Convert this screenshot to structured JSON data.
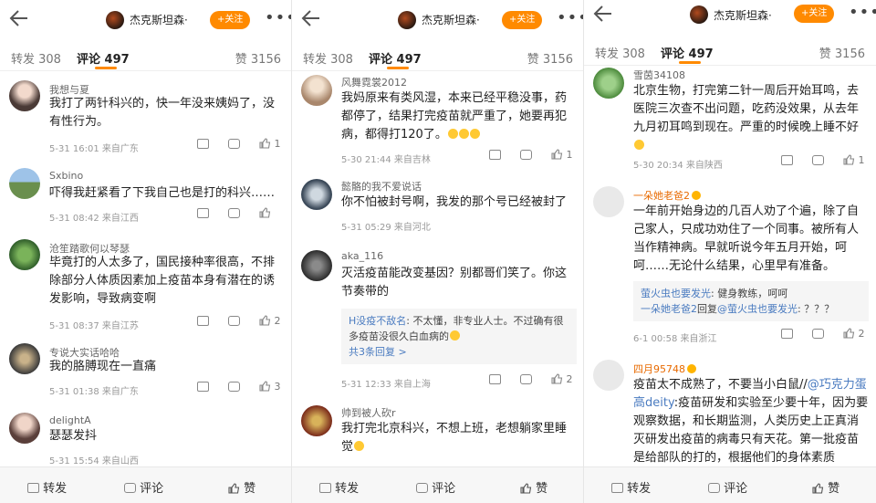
{
  "account_name": "杰克斯坦森·",
  "follow_label": "+关注",
  "tabs": {
    "repost": "转发 308",
    "comments": "评论 497",
    "likes": "赞 3156"
  },
  "bottom_bar": {
    "repost": "转发",
    "comment": "评论",
    "like": "赞"
  },
  "colors": {
    "accent": "#ff8a00",
    "link": "#4a7bc0",
    "vip_name": "#e86a00"
  },
  "panel1": [
    {
      "user": "我想与夏",
      "text": "我打了两针科兴的，快一年没来姨妈了，没有性行为。",
      "meta": "5-31 16:01  来自广东",
      "likes": "1"
    },
    {
      "user": "Sxbino",
      "text": "吓得我赶紧看了下我自己也是打的科兴……",
      "meta": "5-31 08:42  来自江西",
      "likes": ""
    },
    {
      "user": "沧笙踏歌何以琴瑟",
      "text": "毕竟打的人太多了，国民接种率很高，不排除部分人体质因素加上疫苗本身有潜在的诱发影响，导致病变啊",
      "meta": "5-31 08:37  来自江苏",
      "likes": "2"
    },
    {
      "user": "专说大实话哈哈",
      "text": "我的胳膊现在一直痛",
      "meta": "5-31 01:38  来自广东",
      "likes": "3"
    },
    {
      "user": "delightA",
      "text": "瑟瑟发抖",
      "meta": "5-31 15:54  来自山西",
      "likes": ""
    }
  ],
  "panel2": [
    {
      "user": "风舞霓裳2012",
      "text": "我妈原来有类风湿，本来已经平稳没事，药都停了，结果打完疫苗就严重了，她要再犯病，都得打120了。",
      "meta": "5-30 21:44  来自吉林",
      "likes": "1"
    },
    {
      "user": "懿骼的我不爱说话",
      "text": "你不怕被封号啊，我发的那个号已经被封了",
      "meta": "5-31 05:29  来自河北",
      "likes": ""
    },
    {
      "user": "aka_116",
      "text": "灭活疫苗能改变基因？别都哥们笑了。你这节奏带的",
      "meta": "5-31 12:33  来自上海",
      "likes": "2",
      "reply_user": "H没疫不敌名",
      "reply_text": ": 不太懂，非专业人士。不过确有很多疫苗没很久白血病的",
      "reply_more": "共3条回复 >"
    },
    {
      "user": "帅到被人砍r",
      "text": "我打完北京科兴，不想上班，老想躺家里睡觉",
      "meta": "",
      "likes": ""
    }
  ],
  "panel3": [
    {
      "user": "雪茵34108",
      "text": "北京生物，打完第二针一周后开始耳鸣，去医院三次查不出问题，吃药没效果，从去年九月初耳鸣到现在。严重的时候晚上睡不好",
      "meta": "5-30 20:34  来自陕西",
      "likes": "1"
    },
    {
      "user": "一朵她老爸2",
      "text": "一年前开始身边的几百人劝了个遍，除了自己家人，只成功劝住了一个同事。被所有人当作精神病。早就听说今年五月开始，呵呵……无论什么结果，心里早有准备。",
      "meta": "6-1 00:58  来自浙江",
      "likes": "2",
      "r1_user": "萤火虫也要发光",
      "r1_text": ": 健身教练，呵呵",
      "r2_user": "一朵她老爸2",
      "r2_mid": "回复",
      "r2_user2": "@萤火虫也要发光",
      "r2_text": ": ？？？"
    },
    {
      "user": "四月95748",
      "text_pre": "疫苗太不成熟了，不要当小白鼠//",
      "mention": "@巧克力蛋高deity",
      "text_post": ":疫苗研发和实验至少要十年，因为要观察数据，和长期监测，人类历史上正真消灭研发出疫苗的病毒只有天花。第一批疫苗是给部队的打的，根据他们的身体素质",
      "meta": "",
      "likes": ""
    }
  ]
}
